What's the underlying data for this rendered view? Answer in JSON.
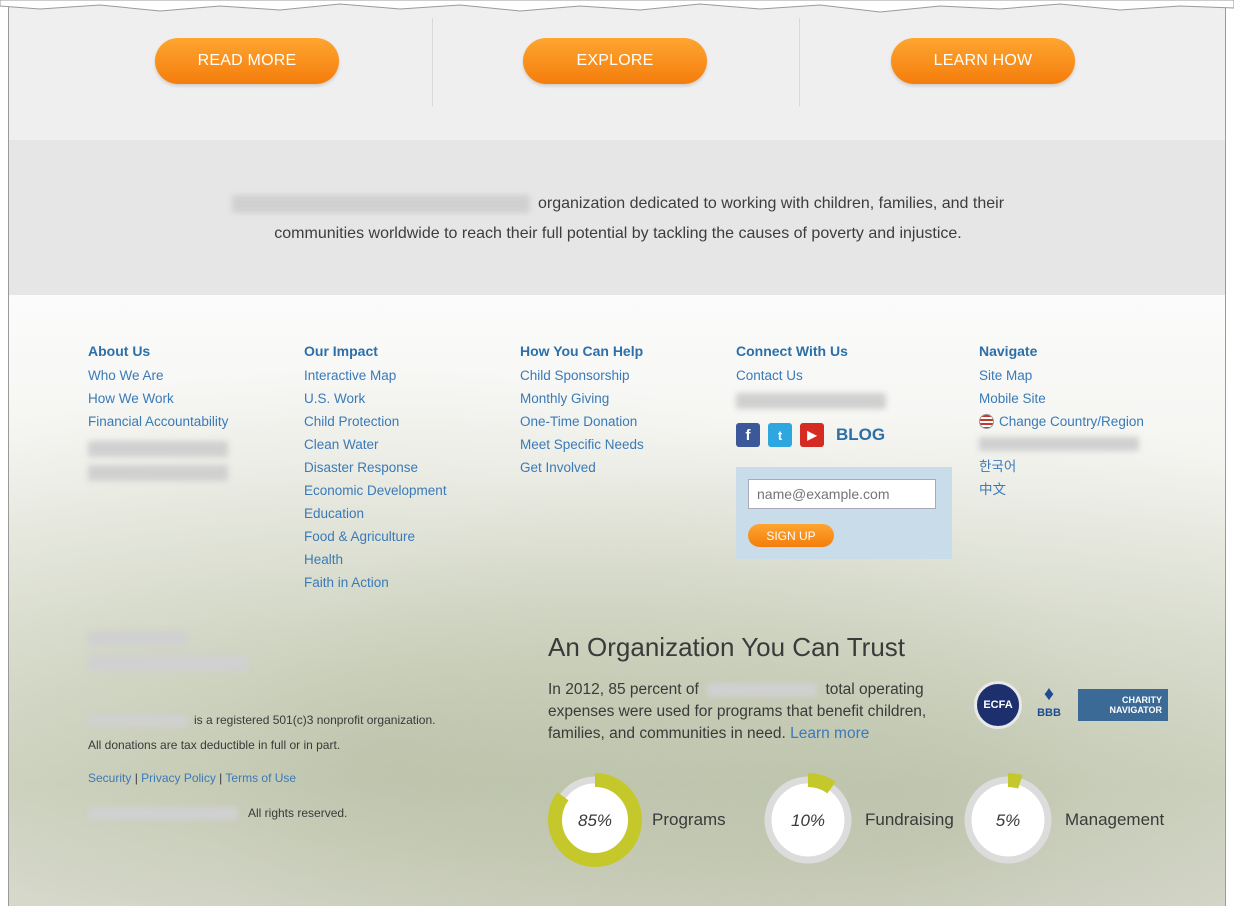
{
  "cta": {
    "buttons": [
      "READ MORE",
      "EXPLORE",
      "LEARN HOW"
    ]
  },
  "mission": {
    "line1": "organization dedicated to working with children, families, and their",
    "line2": "communities worldwide to reach their full potential by tackling the causes of poverty and injustice."
  },
  "footer": {
    "columns": [
      {
        "title": "About Us",
        "links": [
          "Who We Are",
          "How We Work",
          "Financial Accountability"
        ]
      },
      {
        "title": "Our Impact",
        "links": [
          "Interactive Map",
          "U.S. Work",
          "Child Protection",
          "Clean Water",
          "Disaster Response",
          "Economic Development",
          "Education",
          "Food & Agriculture",
          "Health",
          "Faith in Action"
        ]
      },
      {
        "title": "How You Can Help",
        "links": [
          "Child Sponsorship",
          "Monthly Giving",
          "One-Time Donation",
          "Meet Specific Needs",
          "Get Involved"
        ]
      },
      {
        "title": "Connect With Us",
        "links": [
          "Contact Us"
        ]
      },
      {
        "title": "Navigate",
        "links": [
          "Site Map",
          "Mobile Site",
          "Change Country/Region"
        ]
      }
    ],
    "languages": [
      "한국어",
      "中文"
    ],
    "blog_label": "BLOG",
    "email_placeholder": "name@example.com",
    "signup_label": "SIGN UP"
  },
  "trust": {
    "title": "An Organization You Can Trust",
    "text_part1": "In 2012, 85 percent of",
    "text_part2": "total operating expenses were used for programs that benefit children, families, and communities in need.",
    "learn_more": "Learn more",
    "badges": {
      "ecfa": "ECFA",
      "bbb": "BBB",
      "charity_navigator": "CHARITY NAVIGATOR"
    },
    "stats": [
      {
        "value": "85%",
        "label": "Programs",
        "fraction": 0.85
      },
      {
        "value": "10%",
        "label": "Fundraising",
        "fraction": 0.1
      },
      {
        "value": "5%",
        "label": "Management",
        "fraction": 0.05
      }
    ]
  },
  "legal": {
    "registered": "is a registered 501(c)3 nonprofit organization.",
    "deductible": "All donations are tax deductible in full or in part.",
    "links": [
      "Security",
      "Privacy Policy",
      "Terms of Use"
    ],
    "rights": "All rights reserved."
  },
  "colors": {
    "accent_orange": "#f47d0c",
    "link_blue": "#3a7ab8",
    "heading_blue": "#2d6fa8",
    "donut_green": "#c4c82a"
  }
}
